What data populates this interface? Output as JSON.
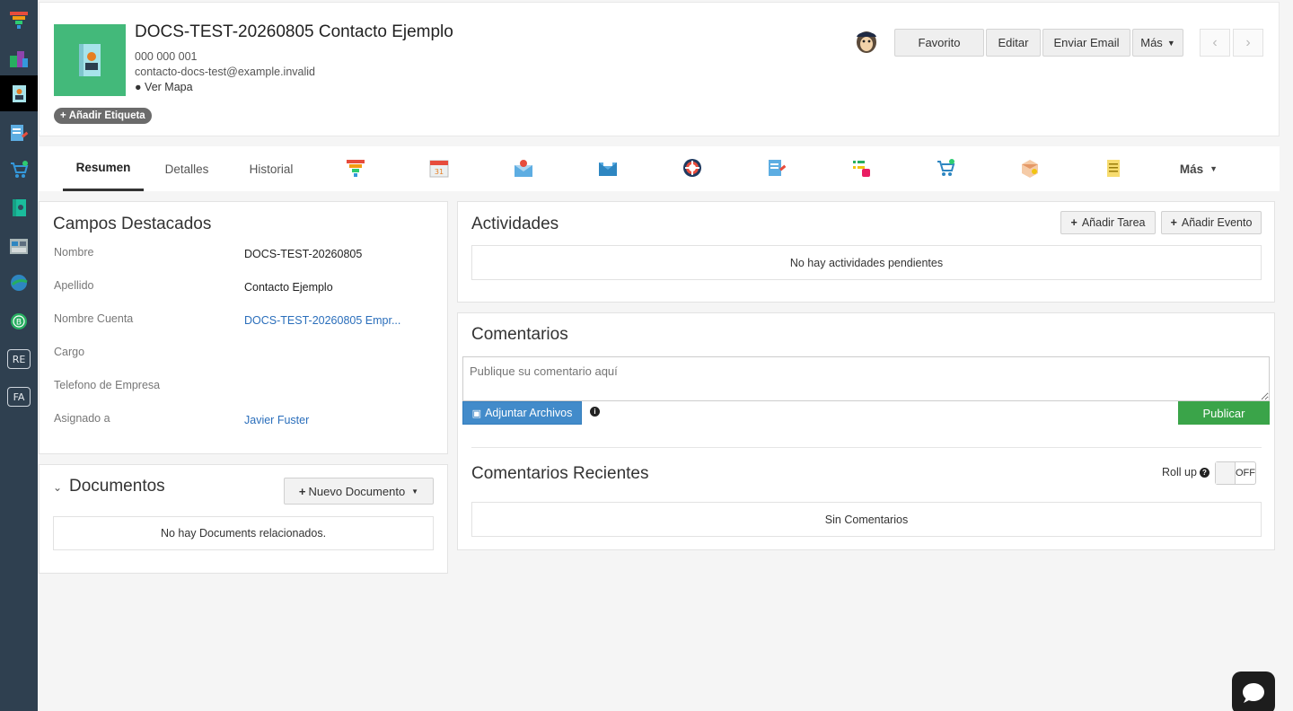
{
  "sidebar": {
    "items": [
      {
        "icon": "funnel-icon"
      },
      {
        "icon": "buildings-icon"
      },
      {
        "icon": "contact-icon"
      },
      {
        "icon": "document-pen-icon"
      },
      {
        "icon": "cart-icon"
      },
      {
        "icon": "book-icon"
      },
      {
        "icon": "calendar-board-icon"
      },
      {
        "icon": "globe-icon"
      },
      {
        "icon": "circle-b-icon"
      },
      {
        "icon": "re-icon",
        "label": "RE"
      },
      {
        "icon": "fa-icon",
        "label": "FA"
      }
    ]
  },
  "record": {
    "title": "DOCS-TEST-20260805 Contacto Ejemplo",
    "phone": "000 000 001",
    "email": "contacto-docs-test@example.invalid",
    "map_link": "Ver Mapa",
    "add_tag": "Añadir Etiqueta"
  },
  "header_actions": {
    "favorite": "Favorito",
    "edit": "Editar",
    "send_email": "Enviar Email",
    "more": "Más"
  },
  "tabs": {
    "summary": "Resumen",
    "details": "Detalles",
    "history": "Historial",
    "more": "Más",
    "icons": [
      "funnel-icon",
      "calendar-icon",
      "email-pin-icon",
      "envelope-icon",
      "lifebuoy-icon",
      "document-edit-icon",
      "task-list-icon",
      "cart-add-icon",
      "box-icon",
      "notes-icon"
    ]
  },
  "highlights": {
    "title": "Campos Destacados",
    "fields": [
      {
        "label": "Nombre",
        "value": "DOCS-TEST-20260805"
      },
      {
        "label": "Apellido",
        "value": "Contacto Ejemplo"
      },
      {
        "label": "Nombre Cuenta",
        "value": "DOCS-TEST-20260805 Empr..."
      },
      {
        "label": "Cargo",
        "value": ""
      },
      {
        "label": "Telefono de Empresa",
        "value": ""
      },
      {
        "label": "Asignado a",
        "value": "Javier Fuster"
      }
    ]
  },
  "documents": {
    "title": "Documentos",
    "new_button": "Nuevo Documento",
    "empty": "No hay Documents relacionados."
  },
  "activities": {
    "title": "Actividades",
    "add_task": "Añadir Tarea",
    "add_event": "Añadir Evento",
    "empty": "No hay actividades pendientes"
  },
  "comments": {
    "title": "Comentarios",
    "placeholder": "Publique su comentario aquí",
    "attach": "Adjuntar Archivos",
    "publish": "Publicar",
    "recent_title": "Comentarios Recientes",
    "rollup_label": "Roll up",
    "rollup_state": "OFF",
    "empty": "Sin Comentarios"
  },
  "colors": {
    "sidebar_bg": "#2f4050",
    "avatar_bg": "#43b97a",
    "link": "#2a6ebb",
    "attach_btn": "#428bca",
    "publish_btn": "#3aa449"
  }
}
